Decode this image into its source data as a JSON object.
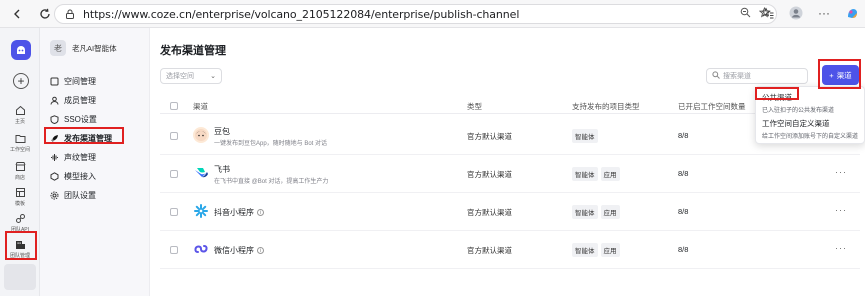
{
  "browser": {
    "url": "https://www.coze.cn/enterprise/volcano_2105122084/enterprise/publish-channel"
  },
  "rail": {
    "items": [
      {
        "label": "主页",
        "icon": "home-icon"
      },
      {
        "label": "工作空间",
        "icon": "folder-icon"
      },
      {
        "label": "商店",
        "icon": "store-icon"
      },
      {
        "label": "模板",
        "icon": "template-icon"
      },
      {
        "label": "团队API",
        "icon": "api-icon"
      },
      {
        "label": "团队管理",
        "icon": "team-manage-icon"
      }
    ]
  },
  "sidebar": {
    "team_name": "老凡AI智能体",
    "items": [
      {
        "label": "空间管理",
        "icon": "space-icon"
      },
      {
        "label": "成员管理",
        "icon": "members-icon"
      },
      {
        "label": "SSO设置",
        "icon": "sso-icon"
      },
      {
        "label": "发布渠道管理",
        "icon": "rocket-icon"
      },
      {
        "label": "声纹管理",
        "icon": "voiceprint-icon"
      },
      {
        "label": "模型接入",
        "icon": "model-icon"
      },
      {
        "label": "团队设置",
        "icon": "settings-icon"
      }
    ]
  },
  "main": {
    "title": "发布渠道管理",
    "space_select_placeholder": "选择空间",
    "search_placeholder": "搜索渠道",
    "add_button_label": "渠道",
    "columns": [
      "渠道",
      "类型",
      "支持发布的项目类型",
      "已开启工作空间数量"
    ],
    "rows": [
      {
        "name": "豆包",
        "desc": "一键发布到豆包App，随时随地与 Bot 对话",
        "type": "官方默认渠道",
        "tags": [
          "智能体"
        ],
        "count": "8/8",
        "has_info": false
      },
      {
        "name": "飞书",
        "desc": "在飞书中直接 @Bot 对话，提高工作生产力",
        "type": "官方默认渠道",
        "tags": [
          "智能体",
          "应用"
        ],
        "count": "8/8",
        "has_info": false
      },
      {
        "name": "抖音小程序",
        "desc": "",
        "type": "官方默认渠道",
        "tags": [
          "智能体",
          "应用"
        ],
        "count": "8/8",
        "has_info": true
      },
      {
        "name": "微信小程序",
        "desc": "",
        "type": "官方默认渠道",
        "tags": [
          "智能体",
          "应用"
        ],
        "count": "8/8",
        "has_info": true
      }
    ]
  },
  "menu": {
    "items": [
      {
        "title": "公共渠道",
        "desc": "已入驻扣子的公共发布渠道"
      },
      {
        "title": "工作空间自定义渠道",
        "desc": "给工作空间添加账号下的自定义渠道"
      }
    ]
  },
  "colors": {
    "accent": "#4d53e8",
    "highlight": "#e02020"
  }
}
